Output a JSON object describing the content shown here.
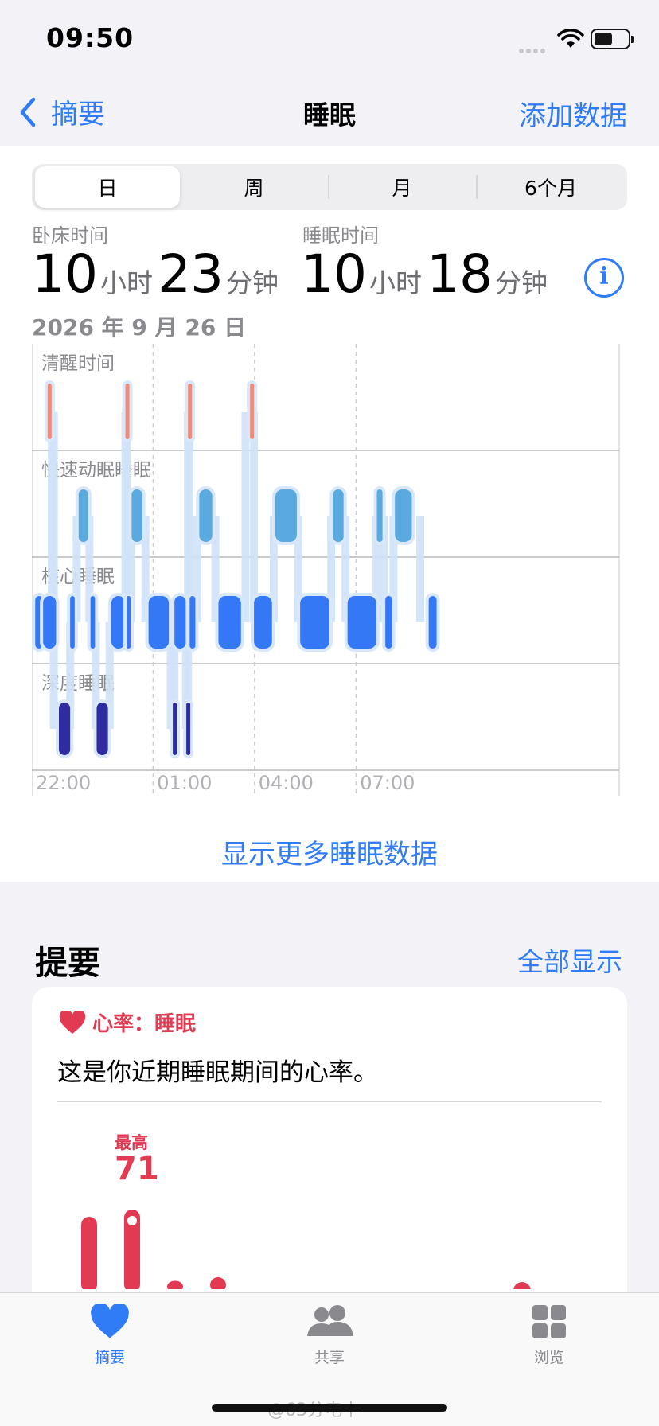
{
  "status_bar": {
    "time": "09:50"
  },
  "nav": {
    "back_label": "摘要",
    "title": "睡眠",
    "action_label": "添加数据"
  },
  "segments": [
    "日",
    "周",
    "月",
    "6个月"
  ],
  "selected_segment": "日",
  "stats": {
    "in_bed": {
      "label": "卧床时间",
      "hours": "10",
      "hours_unit": "小时",
      "minutes": "23",
      "minutes_unit": "分钟"
    },
    "asleep": {
      "label": "睡眠时间",
      "hours": "10",
      "hours_unit": "小时",
      "minutes": "18",
      "minutes_unit": "分钟"
    }
  },
  "date": "2026 年 9 月 26 日",
  "chart_data": {
    "type": "sleep-stages",
    "stages": [
      "清醒时间",
      "快速动眠睡眠",
      "核心睡眠",
      "深度睡眠"
    ],
    "x_ticks": [
      "22:00",
      "01:00",
      "04:00",
      "07:00"
    ],
    "colors": {
      "awake": "#f27b63",
      "rem": "#5aaae0",
      "core": "#3478f6",
      "deep": "#2e2c9e"
    },
    "segments": [
      {
        "stage": "core",
        "start": "21:31",
        "end": "21:45"
      },
      {
        "stage": "core",
        "start": "21:45",
        "end": "22:08"
      },
      {
        "stage": "awake",
        "start": "21:53",
        "end": "21:55"
      },
      {
        "stage": "deep",
        "start": "22:13",
        "end": "22:33"
      },
      {
        "stage": "core",
        "start": "22:33",
        "end": "22:41"
      },
      {
        "stage": "rem",
        "start": "22:48",
        "end": "23:05"
      },
      {
        "stage": "core",
        "start": "23:09",
        "end": "23:17"
      },
      {
        "stage": "deep",
        "start": "23:20",
        "end": "23:40"
      },
      {
        "stage": "core",
        "start": "23:46",
        "end": "00:11"
      },
      {
        "stage": "awake",
        "start": "00:11",
        "end": "00:13"
      },
      {
        "stage": "core",
        "start": "00:13",
        "end": "00:20"
      },
      {
        "stage": "rem",
        "start": "00:22",
        "end": "00:41"
      },
      {
        "stage": "core",
        "start": "00:52",
        "end": "01:28"
      },
      {
        "stage": "deep",
        "start": "01:35",
        "end": "01:38"
      },
      {
        "stage": "core",
        "start": "01:38",
        "end": "01:58"
      },
      {
        "stage": "deep",
        "start": "01:59",
        "end": "02:02"
      },
      {
        "stage": "awake",
        "start": "02:02",
        "end": "02:04"
      },
      {
        "stage": "core",
        "start": "02:05",
        "end": "02:15"
      },
      {
        "stage": "rem",
        "start": "02:22",
        "end": "02:45"
      },
      {
        "stage": "core",
        "start": "02:56",
        "end": "03:36"
      },
      {
        "stage": "awake",
        "start": "03:52",
        "end": "03:59"
      },
      {
        "stage": "core",
        "start": "03:59",
        "end": "04:31"
      },
      {
        "stage": "rem",
        "start": "04:37",
        "end": "05:15"
      },
      {
        "stage": "core",
        "start": "05:21",
        "end": "06:13"
      },
      {
        "stage": "rem",
        "start": "06:19",
        "end": "06:38"
      },
      {
        "stage": "core",
        "start": "06:45",
        "end": "07:36"
      },
      {
        "stage": "rem",
        "start": "07:37",
        "end": "07:47"
      },
      {
        "stage": "core",
        "start": "07:52",
        "end": "08:04"
      },
      {
        "stage": "rem",
        "start": "08:09",
        "end": "08:39"
      },
      {
        "stage": "core",
        "start": "09:09",
        "end": "09:23"
      }
    ]
  },
  "more_link": "显示更多睡眠数据",
  "summary": {
    "title": "提要",
    "show_all": "全部显示",
    "card": {
      "heading": "心率：睡眠",
      "description": "这是你近期睡眠期间的心率。",
      "max_label": "最高",
      "max_value": "71",
      "bars_bpm": [
        69,
        71,
        60,
        61
      ]
    }
  },
  "tabs": [
    {
      "label": "摘要",
      "icon": "heart-icon",
      "active": true
    },
    {
      "label": "共享",
      "icon": "people-icon",
      "active": false
    },
    {
      "label": "浏览",
      "icon": "grid-icon",
      "active": false
    }
  ],
  "watermark": "@63分电中",
  "colors": {
    "accent": "#2f7cf6",
    "heart": "#e33a53"
  }
}
